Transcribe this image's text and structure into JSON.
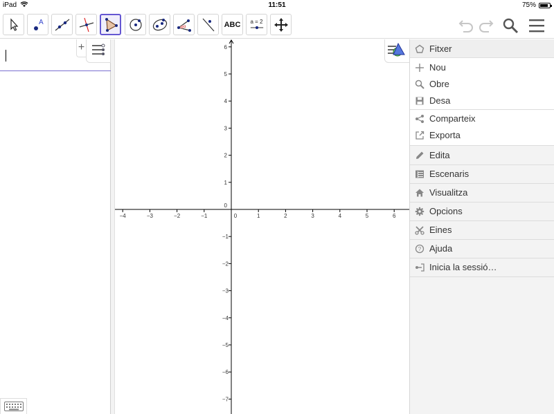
{
  "status": {
    "device": "iPad",
    "time": "11:51",
    "battery": "75%"
  },
  "toolbar": {
    "tools": [
      {
        "id": "move",
        "icon": "arrow-pointer-icon"
      },
      {
        "id": "point",
        "icon": "point-icon"
      },
      {
        "id": "line",
        "icon": "line-icon"
      },
      {
        "id": "perpendicular",
        "icon": "perpendicular-line-icon"
      },
      {
        "id": "polygon",
        "icon": "polygon-icon",
        "selected": true
      },
      {
        "id": "circle",
        "icon": "circle-center-icon"
      },
      {
        "id": "ellipse",
        "icon": "ellipse-icon"
      },
      {
        "id": "angle",
        "icon": "angle-icon"
      },
      {
        "id": "reflect",
        "icon": "reflect-line-icon"
      },
      {
        "id": "text",
        "label": "ABC"
      },
      {
        "id": "slider",
        "label": "a = 2"
      },
      {
        "id": "move-view",
        "icon": "move-view-icon"
      }
    ]
  },
  "graphics": {
    "x_ticks": [
      "−4",
      "−3",
      "−2",
      "−1",
      "0",
      "1",
      "2",
      "3",
      "4",
      "5",
      "6"
    ],
    "y_ticks_pos": [
      "6",
      "5",
      "4",
      "3",
      "2",
      "1"
    ],
    "y_ticks_neg": [
      "−1",
      "−2",
      "−3",
      "−4",
      "−5",
      "−6",
      "−7"
    ],
    "y_zero": "0"
  },
  "menu": {
    "file_header": "Fitxer",
    "file_items": [
      "Nou",
      "Obre",
      "Desa"
    ],
    "share_items": [
      "Comparteix",
      "Exporta"
    ],
    "main_items": [
      "Edita",
      "Escenaris",
      "Visualitza",
      "Opcions",
      "Eines",
      "Ajuda",
      "Inicia la sessió…"
    ]
  },
  "colors": {
    "accent": "#6557d2",
    "axis": "#000000"
  }
}
